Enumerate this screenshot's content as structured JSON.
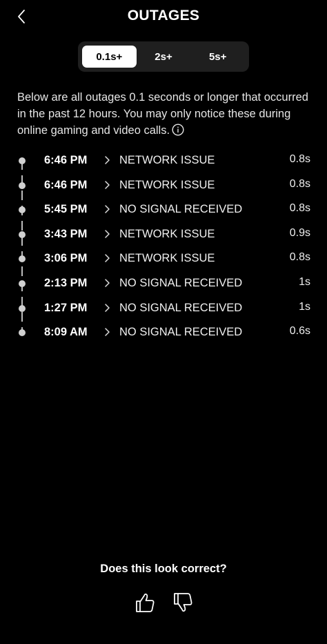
{
  "header": {
    "title": "OUTAGES",
    "back_icon": "chevron-left-icon"
  },
  "filters": {
    "options": [
      {
        "label": "0.1s+",
        "active": true
      },
      {
        "label": "2s+",
        "active": false
      },
      {
        "label": "5s+",
        "active": false
      }
    ]
  },
  "description": {
    "text": "Below are all outages 0.1 seconds or longer that occurred in the past 12 hours. You may only notice these during online gaming and video calls.",
    "info_icon": "info-icon"
  },
  "outages": [
    {
      "time": "6:46 PM",
      "reason": "NETWORK ISSUE",
      "duration": "0.8s"
    },
    {
      "time": "6:46 PM",
      "reason": "NETWORK ISSUE",
      "duration": "0.8s"
    },
    {
      "time": "5:45 PM",
      "reason": "NO SIGNAL RECEIVED",
      "duration": "0.8s"
    },
    {
      "time": "3:43 PM",
      "reason": "NETWORK ISSUE",
      "duration": "0.9s"
    },
    {
      "time": "3:06 PM",
      "reason": "NETWORK ISSUE",
      "duration": "0.8s"
    },
    {
      "time": "2:13 PM",
      "reason": "NO SIGNAL RECEIVED",
      "duration": "1s"
    },
    {
      "time": "1:27 PM",
      "reason": "NO SIGNAL RECEIVED",
      "duration": "1s"
    },
    {
      "time": "8:09 AM",
      "reason": "NO SIGNAL RECEIVED",
      "duration": "0.6s"
    }
  ],
  "feedback": {
    "question": "Does this look correct?",
    "up_icon": "thumbs-up-icon",
    "down_icon": "thumbs-down-icon"
  },
  "colors": {
    "background": "#000000",
    "text": "#ffffff",
    "segment_bg": "#1f1f1f",
    "timeline": "#bdbdbd"
  }
}
